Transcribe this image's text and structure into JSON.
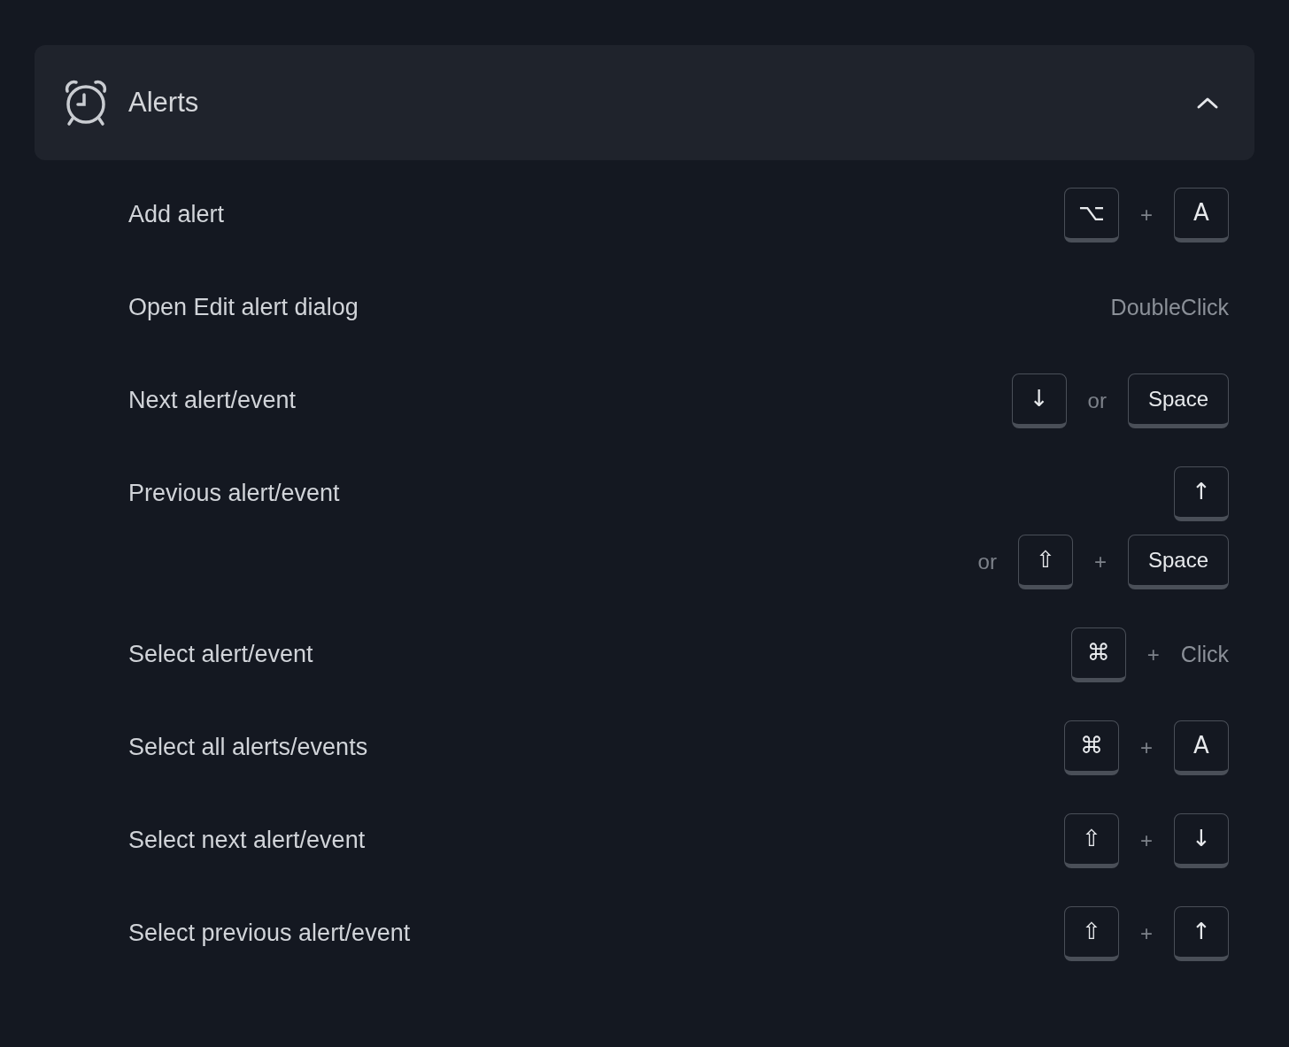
{
  "section": {
    "title": "Alerts",
    "expanded": true
  },
  "shortcuts": [
    {
      "label": "Add alert",
      "lines": [
        [
          {
            "kind": "key",
            "text": "⌥"
          },
          {
            "kind": "sep",
            "text": "+"
          },
          {
            "kind": "key",
            "text": "A"
          }
        ]
      ]
    },
    {
      "label": "Open Edit alert dialog",
      "lines": [
        [
          {
            "kind": "text",
            "text": "DoubleClick"
          }
        ]
      ]
    },
    {
      "label": "Next alert/event",
      "lines": [
        [
          {
            "kind": "key",
            "text": "↓"
          },
          {
            "kind": "sep",
            "text": "or"
          },
          {
            "kind": "key",
            "text": "Space"
          }
        ]
      ]
    },
    {
      "label": "Previous alert/event",
      "lines": [
        [
          {
            "kind": "key",
            "text": "↑"
          }
        ],
        [
          {
            "kind": "sep",
            "text": "or"
          },
          {
            "kind": "key",
            "text": "⇧"
          },
          {
            "kind": "sep",
            "text": "+"
          },
          {
            "kind": "key",
            "text": "Space"
          }
        ]
      ]
    },
    {
      "label": "Select alert/event",
      "lines": [
        [
          {
            "kind": "key",
            "text": "⌘"
          },
          {
            "kind": "sep",
            "text": "+"
          },
          {
            "kind": "text",
            "text": "Click"
          }
        ]
      ]
    },
    {
      "label": "Select all alerts/events",
      "lines": [
        [
          {
            "kind": "key",
            "text": "⌘"
          },
          {
            "kind": "sep",
            "text": "+"
          },
          {
            "kind": "key",
            "text": "A"
          }
        ]
      ]
    },
    {
      "label": "Select next alert/event",
      "lines": [
        [
          {
            "kind": "key",
            "text": "⇧"
          },
          {
            "kind": "sep",
            "text": "+"
          },
          {
            "kind": "key",
            "text": "↓"
          }
        ]
      ]
    },
    {
      "label": "Select previous alert/event",
      "lines": [
        [
          {
            "kind": "key",
            "text": "⇧"
          },
          {
            "kind": "sep",
            "text": "+"
          },
          {
            "kind": "key",
            "text": "↑"
          }
        ]
      ]
    }
  ]
}
